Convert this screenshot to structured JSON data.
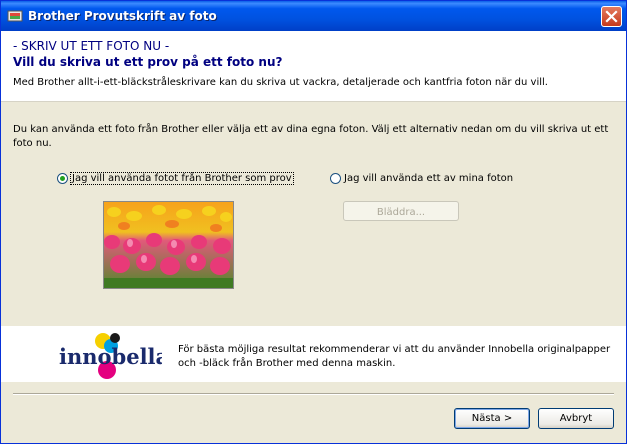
{
  "window": {
    "title": "Brother Provutskrift av foto"
  },
  "header": {
    "title": "- SKRIV UT ETT FOTO NU -",
    "subtitle": "Vill du skriva ut ett prov på ett foto nu?",
    "description": "Med Brother allt-i-ett-bläckstråleskrivare kan du skriva ut vackra, detaljerade och kantfria foton när du vill."
  },
  "intro_text": "Du kan använda ett foto från Brother eller välja ett av dina egna foton. Välj ett alternativ nedan om du vill skriva ut ett foto nu.",
  "options": {
    "brother_photo": {
      "label": "Jag vill använda fotot från Brother som prov",
      "checked": true
    },
    "own_photo": {
      "label": "Jag vill använda ett av mina foton",
      "checked": false
    }
  },
  "browse_button": {
    "label": "Bläddra...",
    "enabled": false
  },
  "footer": {
    "logo_text": "innobella",
    "text": "För bästa möjliga resultat rekommenderar vi att du använder Innobella originalpapper och -bläck från Brother med denna maskin."
  },
  "buttons": {
    "next": "Nästa >",
    "cancel": "Avbryt"
  },
  "colors": {
    "titlebar": "#0055e5",
    "heading": "#000080",
    "dialog_bg": "#ece9d8"
  }
}
